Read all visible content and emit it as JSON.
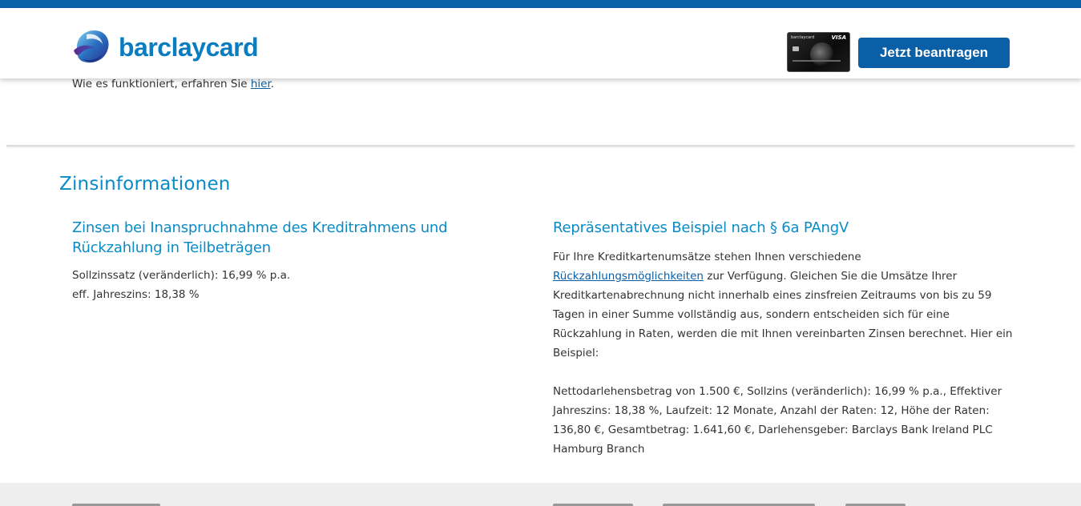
{
  "header": {
    "logo_text": "barclaycard",
    "card_image": {
      "brand_text": "barclaycard",
      "network_text": "VISA"
    },
    "apply_button_label": "Jetzt beantragen"
  },
  "info": {
    "prefix": "Wie es funktioniert, erfahren Sie ",
    "link_label": "hier",
    "suffix": "."
  },
  "zinsinformationen": {
    "title": "Zinsinformationen",
    "left": {
      "title": "Zinsen bei Inanspruchnahme des Kreditrahmens und Rückzahlung in Teilbeträgen",
      "line1": "Sollzinssatz (veränderlich): 16,99 % p.a.",
      "line2": "eff. Jahreszins: 18,38 %"
    },
    "right": {
      "title": "Repräsentatives Beispiel nach § 6a PAngV",
      "p1_before": "Für Ihre Kreditkartenumsätze stehen Ihnen verschiedene ",
      "p1_link": "Rückzahlungsmöglichkeiten",
      "p1_after": " zur Verfügung. Gleichen Sie die Umsätze Ihrer Kreditkartenabrechnung nicht innerhalb eines zinsfreien Zeitraums von bis zu 59 Tagen in einer Summe vollständig aus, sondern entscheiden sich für eine Rückzahlung in Raten, werden die mit Ihnen vereinbarten Zinsen berechnet. Hier ein Beispiel:",
      "p2": "Nettodarlehensbetrag von 1.500 €, Sollzins (veränderlich): 16,99 % p.a., Effektiver Jahreszins: 18,38 %, Laufzeit: 12 Monate, Anzahl der Raten: 12, Höhe der Raten: 136,80 €, Gesamtbetrag: 1.641,60 €, Darlehensgeber: Barclays Bank Ireland PLC Hamburg Branch"
    }
  },
  "colors": {
    "brand_blue": "#0a5fa6",
    "heading_blue": "#0a8bc7",
    "text": "#333333",
    "footer_bg": "#eeeeee"
  }
}
